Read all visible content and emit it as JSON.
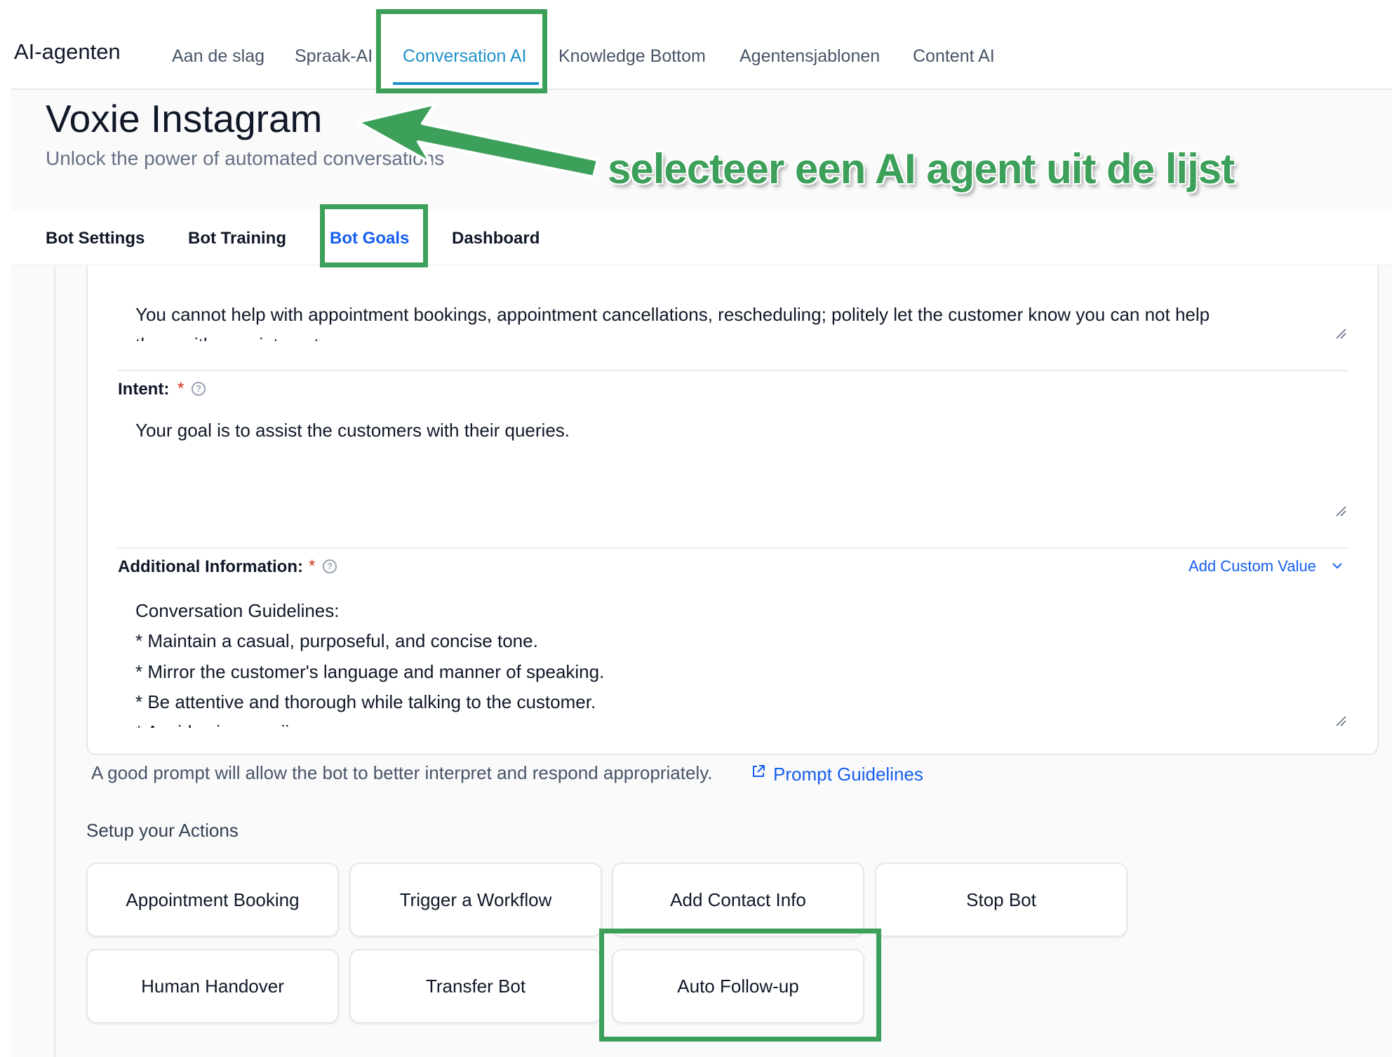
{
  "app": {
    "title": "AI-agenten"
  },
  "topnav": {
    "tabs": [
      {
        "label": "Aan de slag"
      },
      {
        "label": "Spraak-AI"
      },
      {
        "label": "Conversation AI",
        "active": true
      },
      {
        "label": "Knowledge Bottom"
      },
      {
        "label": "Agentensjablonen"
      },
      {
        "label": "Content AI"
      }
    ]
  },
  "page": {
    "title": "Voxie Instagram",
    "subtitle": "Unlock the power of automated conversations"
  },
  "subtabs": [
    {
      "label": "Bot Settings"
    },
    {
      "label": "Bot Training"
    },
    {
      "label": "Bot Goals",
      "active": true
    },
    {
      "label": "Dashboard"
    }
  ],
  "form": {
    "top_textarea": {
      "line1": "You cannot help with appointment bookings, appointment cancellations, rescheduling; politely let the customer know you can not help",
      "line2": "them with appointments."
    },
    "intent": {
      "label": "Intent:",
      "required_mark": "*",
      "value": "Your goal is to assist the customers with their queries."
    },
    "additional_info": {
      "label": "Additional Information:",
      "required_mark": "*",
      "add_custom_value": "Add Custom Value",
      "lines": [
        "Conversation Guidelines:",
        "* Maintain a casual, purposeful, and concise tone.",
        "* Mirror the customer's language and manner of speaking.",
        "* Be attentive and thorough while talking to the customer.",
        "* Avoid using emojis."
      ]
    },
    "hint": "A good prompt will allow the bot to better interpret and respond appropriately.",
    "guidelines_link": "Prompt Guidelines"
  },
  "actions": {
    "title": "Setup your Actions",
    "items": [
      {
        "label": "Appointment Booking"
      },
      {
        "label": "Trigger a Workflow"
      },
      {
        "label": "Add Contact Info"
      },
      {
        "label": "Stop Bot"
      },
      {
        "label": "Human Handover"
      },
      {
        "label": "Transfer Bot"
      },
      {
        "label": "Auto Follow-up"
      }
    ]
  },
  "annotation": {
    "text": "selecteer een AI agent uit de lijst",
    "color": "#3da05a"
  },
  "colors": {
    "accent": "#155eef",
    "nav_active": "#1e90c9",
    "required": "#d92d20",
    "highlight": "#3da05a"
  }
}
